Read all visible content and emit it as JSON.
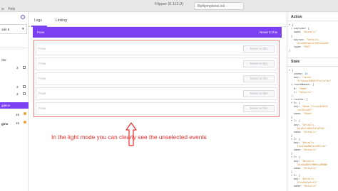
{
  "titlebar": {
    "menu": [
      "w",
      "Help"
    ],
    "title": "Flipper (0.112.0)",
    "device_input": "flipflipmplaneLisk"
  },
  "left_sidebar": {
    "device_select": "ode 6",
    "section_label": "rter",
    "items": [
      {
        "label": "",
        "count": "3"
      },
      {
        "label": "",
        "count": "3"
      },
      {
        "label": "",
        "count": "3"
      },
      {
        "label": "gation",
        "count": "6",
        "active": true
      },
      {
        "label": "",
        "count": "16"
      },
      {
        "label": "gins",
        "count": "15"
      }
    ]
  },
  "tabs": [
    {
      "label": "Logs",
      "active": true
    },
    {
      "label": "Linking",
      "active": false
    }
  ],
  "toolbar": {
    "left": "Pose",
    "right": "Reset to this"
  },
  "rows": [
    {
      "left": "Pose",
      "button": "Reset to this"
    },
    {
      "left": "Pose",
      "button": "Reset to this"
    },
    {
      "left": "Pose",
      "button": "Reset to this"
    },
    {
      "left": "Pose",
      "button": "Reset to this"
    },
    {
      "left": "Pose",
      "button": "Reset to this"
    }
  ],
  "annotation": "In the light mode you can clearly see the unselected events",
  "right_sidebar": {
    "action_title": "Action",
    "action_lines": [
      [
        "▾ {",
        ""
      ],
      [
        "▾ payload: {",
        ""
      ],
      [
        "name: ",
        "\"Details\""
      ],
      [
        "}",
        ""
      ],
      [
        "source: ",
        "\"Details-"
      ],
      [
        "",
        "KlwdHbfpKnfVU9vEoAdH\""
      ],
      [
        "type: ",
        "\"POP\""
      ],
      [
        "}",
        ""
      ]
    ],
    "state_title": "State",
    "state_lines": [
      [
        "▾ {",
        ""
      ],
      [
        "index: ",
        "14"
      ],
      [
        "key: ",
        "\"stack-"
      ],
      [
        "",
        "ScreensJM8UXTFsLCnlJa\""
      ],
      [
        "▾ routeNames: [",
        ""
      ],
      [
        "0: ",
        "\"Home\""
      ],
      [
        "1: ",
        "\"Details\""
      ],
      [
        "]",
        ""
      ],
      [
        "▾ routes: [",
        ""
      ],
      [
        "▾ 0: {",
        ""
      ],
      [
        "key: ",
        "\"Home-7fvJozB1KHf"
      ],
      [
        "",
        "xzL8CnvQ7\""
      ],
      [
        "name: ",
        "\"Home\""
      ],
      [
        "}",
        ""
      ],
      [
        "▾ 1: {",
        ""
      ],
      [
        "key: ",
        "\"Details-"
      ],
      [
        "",
        "HyeAClSHNITHT4FHQ\""
      ],
      [
        "name: ",
        "\"Details\""
      ],
      [
        "}",
        ""
      ],
      [
        "▾ 2: {",
        ""
      ],
      [
        "key: ",
        "\"Details-"
      ],
      [
        "",
        "FpUCOdsMW1kuCMhTdk\""
      ],
      [
        "name: ",
        "\"Details\""
      ],
      [
        "}",
        ""
      ],
      [
        "▾ 3: {",
        ""
      ],
      [
        "key: ",
        "\"Details-"
      ],
      [
        "",
        "2dq0pQRhkYWMhLwBRNW\""
      ],
      [
        "name: ",
        "\"Details\""
      ],
      [
        "}",
        ""
      ],
      [
        "▾ 4: {",
        ""
      ],
      [
        "key: ",
        "\"Details-"
      ],
      [
        "",
        "KlwdHbfpKnfV\""
      ],
      [
        "name: ",
        "\"Details\""
      ]
    ]
  },
  "colors": {
    "accent": "#7b40f2",
    "annotation": "#ee2c2c",
    "highlight_border": "#f07878"
  },
  "icons": [
    "plugin-settings-icon",
    "chevron-down-icon",
    "warning-dot-icon",
    "up-arrow-icon"
  ]
}
